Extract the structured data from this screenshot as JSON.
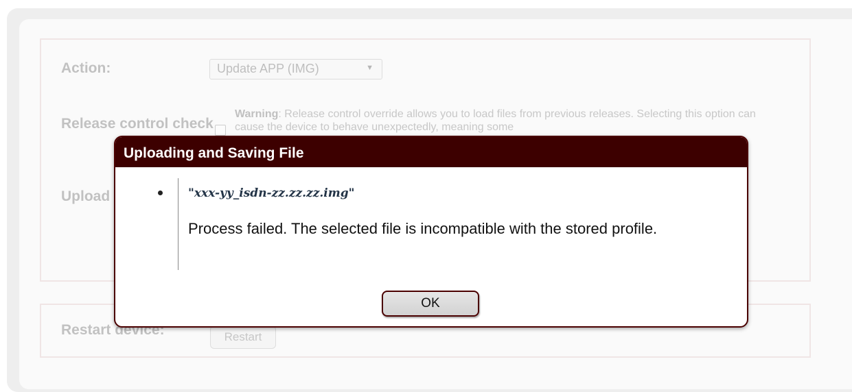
{
  "form": {
    "action_label": "Action:",
    "action_value": "Update APP (IMG)",
    "release_label": "Release control check",
    "warning_bold": "Warning",
    "warning_text": ": Release control override allows you to load files from previous releases. Selecting this option can cause the device to behave unexpectedly, meaning some",
    "upload_label": "Upload",
    "restart_label": "Restart device:",
    "restart_button": "Restart"
  },
  "dialog": {
    "title": "Uploading and Saving File",
    "filename": "\"xxx-yy_isdn-zz.zz.zz.img\"",
    "message": "Process failed. The selected file is incompatible with the stored profile.",
    "ok_label": "OK"
  },
  "colors": {
    "dialog_header": "#3d0000",
    "dialog_border": "#4a0000",
    "fieldset_border": "#e4cccc"
  }
}
